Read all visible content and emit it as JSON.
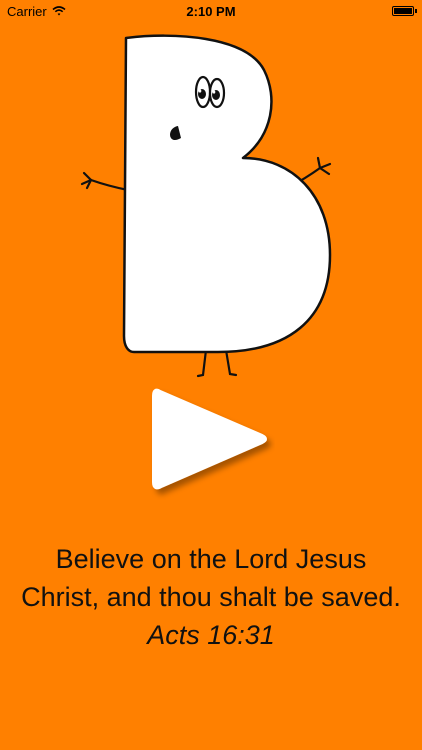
{
  "status_bar": {
    "carrier": "Carrier",
    "time": "2:10 PM",
    "battery_level": 1.0
  },
  "icons": {
    "wifi": "wifi-icon",
    "battery": "battery-icon",
    "play": "play-icon"
  },
  "verse": {
    "text": "Believe on the Lord Jesus Christ, and thou shalt be saved.",
    "reference": "Acts 16:31"
  },
  "colors": {
    "background": "#FF8000",
    "mascot_fill": "#FFFFFF",
    "outline": "#111111"
  }
}
